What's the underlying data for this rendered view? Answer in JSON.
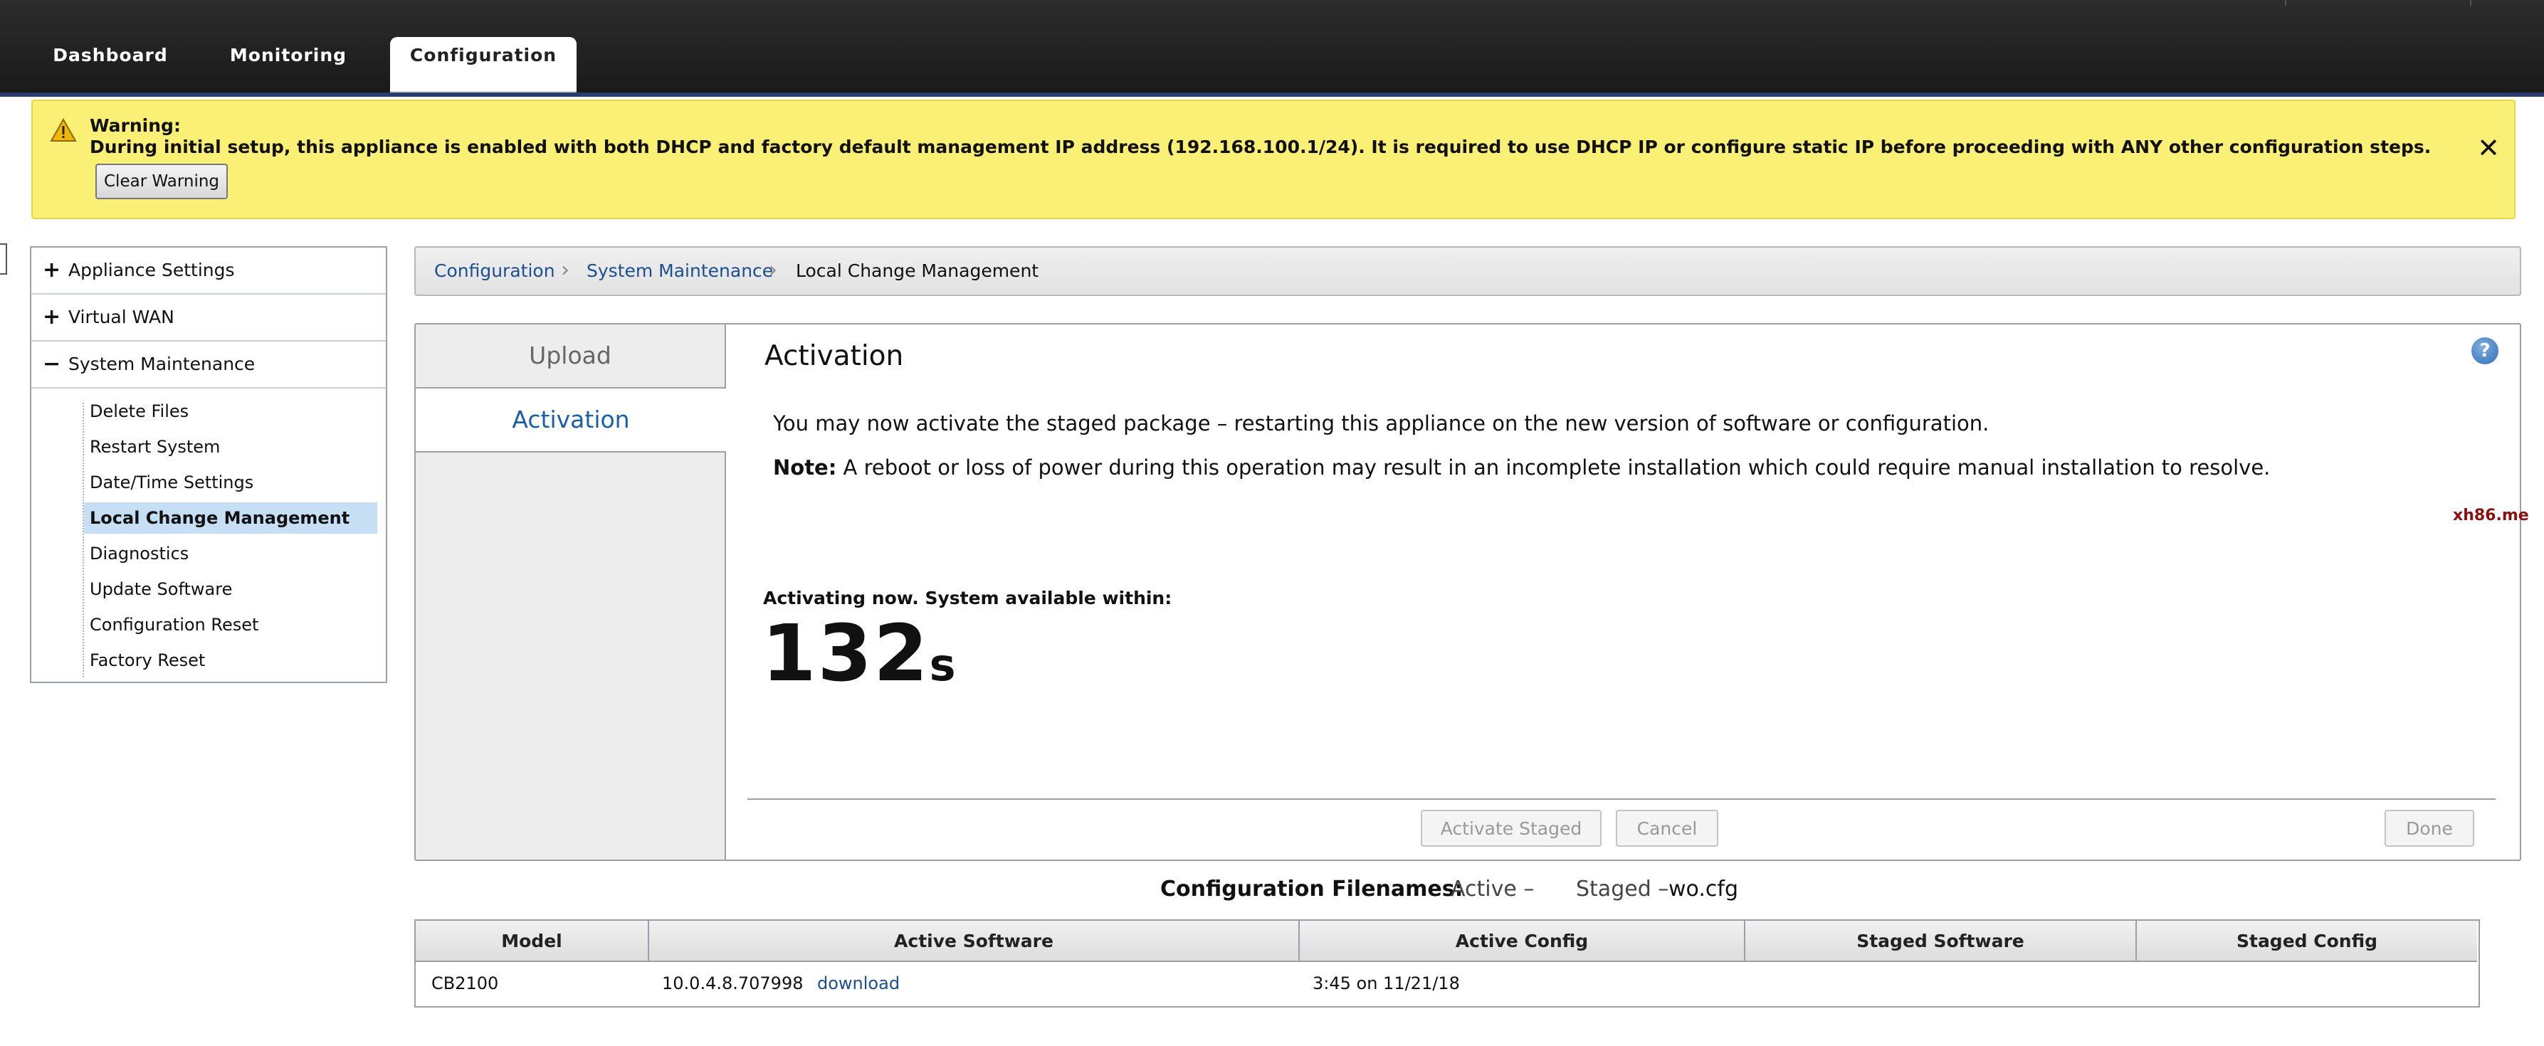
{
  "nav": {
    "tabs": [
      {
        "label": "Dashboard"
      },
      {
        "label": "Monitoring"
      },
      {
        "label": "Configuration"
      }
    ]
  },
  "warning": {
    "title": "Warning:",
    "message": "During initial setup, this appliance is enabled with both DHCP and factory default management IP address (192.168.100.1/24). It is required to use DHCP IP or configure static IP before proceeding with ANY other configuration steps.",
    "clear_button": "Clear Warning",
    "close_symbol": "✕"
  },
  "sidebar": {
    "sections": [
      {
        "symbol": "+",
        "label": "Appliance Settings"
      },
      {
        "symbol": "+",
        "label": "Virtual WAN"
      },
      {
        "symbol": "−",
        "label": "System Maintenance"
      }
    ],
    "items": [
      {
        "label": "Delete Files"
      },
      {
        "label": "Restart System"
      },
      {
        "label": "Date/Time Settings"
      },
      {
        "label": "Local Change Management"
      },
      {
        "label": "Diagnostics"
      },
      {
        "label": "Update Software"
      },
      {
        "label": "Configuration Reset"
      },
      {
        "label": "Factory Reset"
      }
    ],
    "selected_item": "Local Change Management"
  },
  "breadcrumb": [
    "Configuration",
    "System Maintenance",
    "Local Change Management"
  ],
  "panel": {
    "tabs": [
      {
        "label": "Upload"
      },
      {
        "label": "Activation"
      }
    ],
    "title": "Activation",
    "help_icon": "?",
    "description": "You may now activate the staged package – restarting this appliance on the new version of software or configuration.",
    "note_label": "Note:",
    "note_text": " A reboot or loss of power during this operation may result in an incomplete installation which could require manual installation to resolve.",
    "watermark": "xh86.me",
    "activating_label": "Activating now. System available within:",
    "countdown_value": "132",
    "countdown_unit": "s",
    "buttons": {
      "activate": "Activate Staged",
      "cancel": "Cancel",
      "done": "Done"
    }
  },
  "filenames": {
    "label": "Configuration Filenames:",
    "active": "Active –",
    "staged_label": "Staged –",
    "staged_value": "wo.cfg"
  },
  "table": {
    "headers": [
      "Model",
      "Active Software",
      "Active Config",
      "Staged Software",
      "Staged Config"
    ],
    "row": {
      "model": "CB2100",
      "active_software": "10.0.4.8.707998",
      "download": "download",
      "active_config": "3:45 on 11/21/18",
      "staged_software": "",
      "staged_config": ""
    }
  },
  "colors": {
    "warning_bg": "#fbf076",
    "selected_bg": "#c7dff5",
    "link": "#1a4f91",
    "active_tab_text": "#1a5ea8"
  }
}
